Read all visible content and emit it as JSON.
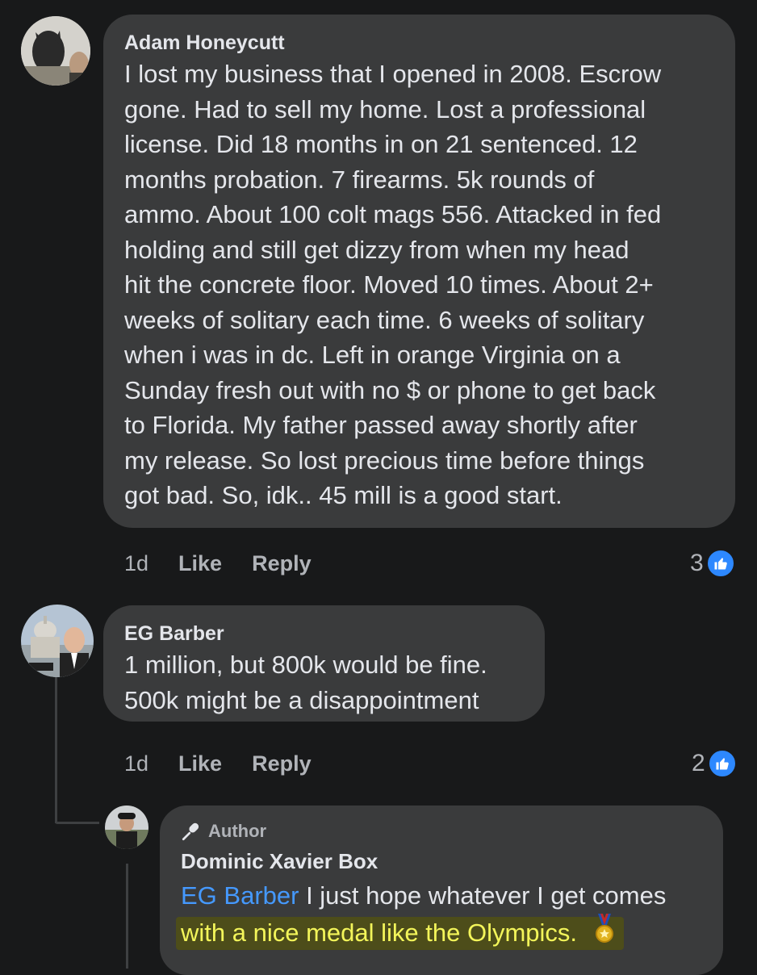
{
  "comments": [
    {
      "author": "Adam Honeycutt",
      "text_lines": [
        "I lost my business that I opened in 2008. Escrow",
        "gone. Had to sell my home. Lost a professional",
        "license. Did 18 months in on 21 sentenced. 12",
        "months probation. 7 firearms. 5k rounds of",
        "ammo. About 100 colt mags 556. Attacked in fed",
        "holding and still get dizzy from when my head",
        "hit the concrete floor. Moved 10 times. About 2+",
        "weeks of solitary each time. 6 weeks of solitary",
        "when i was in dc. Left in orange Virginia on a",
        "Sunday fresh out with no $ or phone to get back",
        "to Florida. My father passed away shortly after",
        "my release. So lost precious time before things",
        "got bad. So, idk.. 45 mill is a good start."
      ],
      "time": "1d",
      "like_label": "Like",
      "reply_label": "Reply",
      "reaction_count": "3",
      "reaction_icon": "thumbs-up-icon"
    },
    {
      "author": "EG Barber",
      "text_lines": [
        "1 million, but 800k would be fine.",
        "500k might be a disappointment"
      ],
      "time": "1d",
      "like_label": "Like",
      "reply_label": "Reply",
      "reaction_count": "2",
      "reaction_icon": "thumbs-up-icon"
    }
  ],
  "reply": {
    "badge_label": "Author",
    "badge_icon": "microphone-icon",
    "author": "Dominic Xavier Box",
    "mention": "EG Barber",
    "line1_rest": " I just hope whatever I get comes",
    "line2": "with a nice medal like the Olympics.",
    "emoji": "🏅"
  },
  "colors": {
    "background": "#18191a",
    "bubble": "#3a3b3c",
    "mention": "#4599ff",
    "highlight_text": "#f3f55a",
    "like_badge": "#2d88ff"
  }
}
